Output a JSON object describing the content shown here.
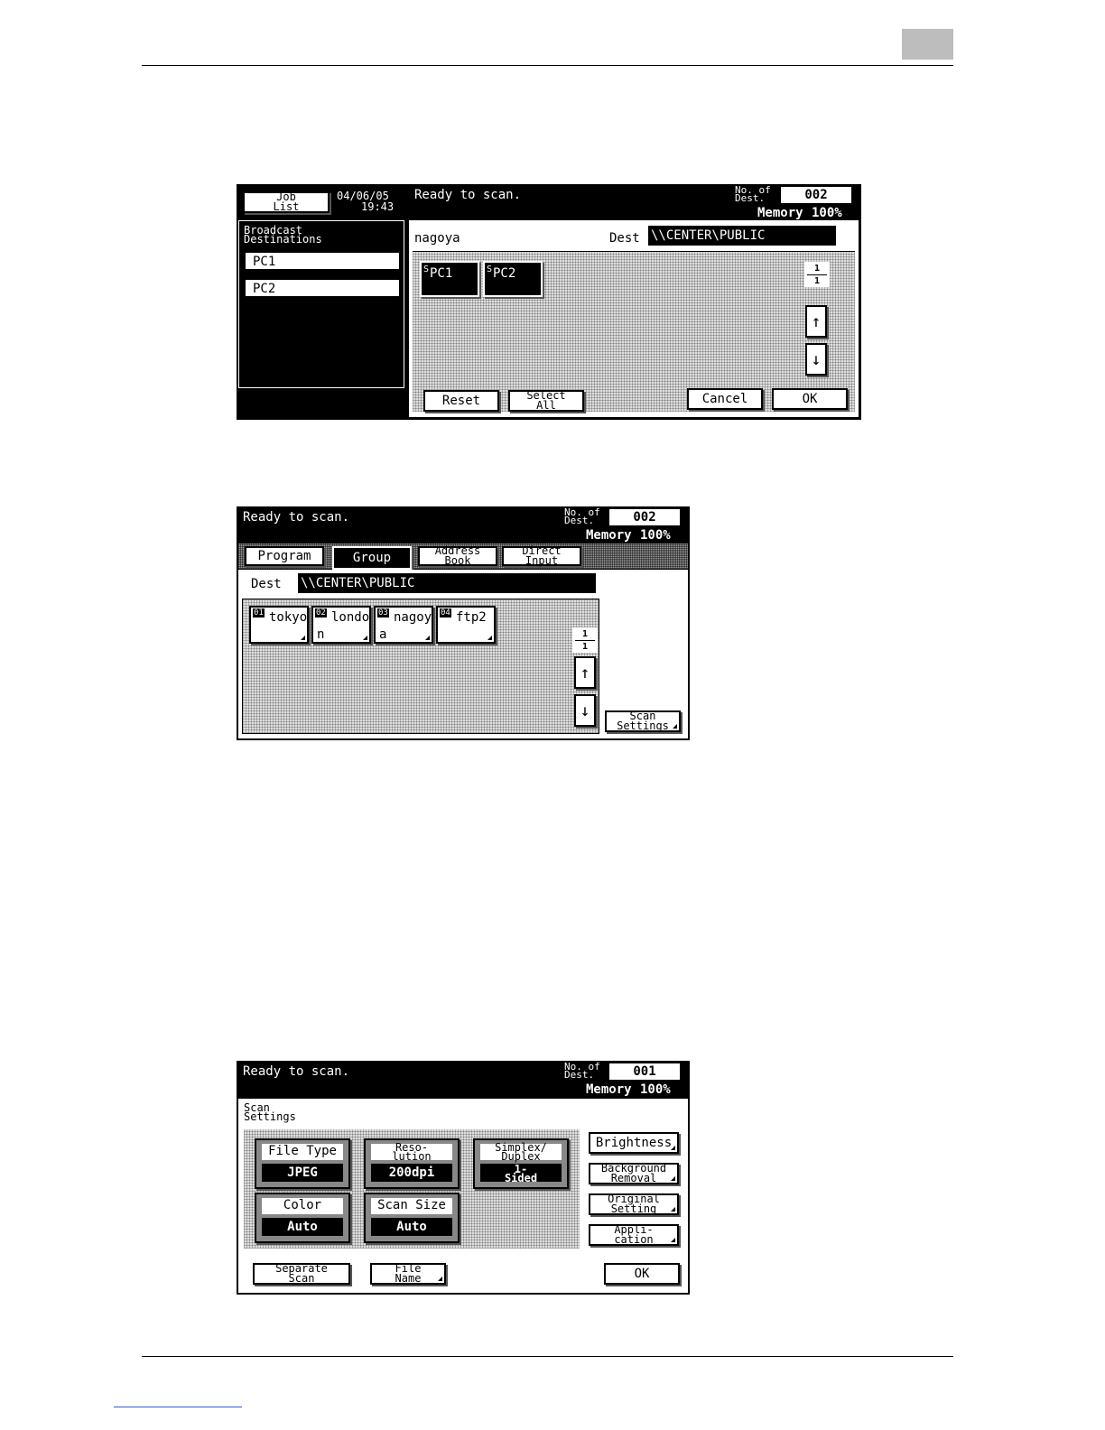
{
  "screen1": {
    "job_list": "Job\nList",
    "date": "04/06/05",
    "time": "19:43",
    "status": "Ready to scan.",
    "no_of_dest_label": "No. of\nDest.",
    "no_of_dest_value": "002",
    "memory_label": "Memory",
    "memory_value": "100%",
    "broadcast_title": "Broadcast\nDestinations",
    "broadcast_items": [
      "PC1",
      "PC2"
    ],
    "group_name": "nagoya",
    "dest_label": "Dest",
    "dest_path": "\\\\CENTER\\PUBLIC",
    "selected_keys": [
      {
        "mark": "S",
        "label": "PC1"
      },
      {
        "mark": "S",
        "label": "PC2"
      }
    ],
    "page_current": "1",
    "page_total": "1",
    "up_arrow": "↑",
    "down_arrow": "↓",
    "reset_label": "Reset",
    "select_all_label": "Select\nAll",
    "cancel_label": "Cancel",
    "ok_label": "OK"
  },
  "screen2": {
    "status": "Ready to scan.",
    "no_of_dest_label": "No. of\nDest.",
    "no_of_dest_value": "002",
    "memory_label": "Memory",
    "memory_value": "100%",
    "tabs": [
      "Program",
      "Group",
      "Address\nBook",
      "Direct\nInput"
    ],
    "dest_label": "Dest",
    "dest_path": "\\\\CENTER\\PUBLIC",
    "groups": [
      {
        "num": "01",
        "line1": "tokyo",
        "line2": ""
      },
      {
        "num": "02",
        "line1": "londo",
        "line2": "n"
      },
      {
        "num": "03",
        "line1": "nagoy",
        "line2": "a"
      },
      {
        "num": "04",
        "line1": "ftp2",
        "line2": ""
      }
    ],
    "page_current": "1",
    "page_total": "1",
    "up_arrow": "↑",
    "down_arrow": "↓",
    "scan_settings_label": "Scan\nSettings"
  },
  "screen3": {
    "status": "Ready to scan.",
    "no_of_dest_label": "No. of\nDest.",
    "no_of_dest_value": "001",
    "memory_label": "Memory",
    "memory_value": "100%",
    "section_title": "Scan\nSettings",
    "file_type": {
      "label": "File Type",
      "value": "JPEG"
    },
    "resolution": {
      "label": "Reso-\nlution",
      "value": "200dpi"
    },
    "simplex": {
      "label": "Simplex/\nDuplex",
      "value": "1-\nSided"
    },
    "color": {
      "label": "Color",
      "value": "Auto"
    },
    "scan_size": {
      "label": "Scan Size",
      "value": "Auto"
    },
    "brightness_label": "Brightness",
    "background_label": "Background\nRemoval",
    "original_label": "Original\nSetting",
    "application_label": "Appli-\ncation",
    "separate_scan_label": "Separate\nScan",
    "file_name_label": "File\nName",
    "ok_label": "OK"
  }
}
